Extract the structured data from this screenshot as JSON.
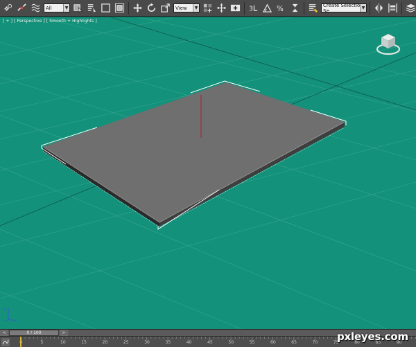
{
  "toolbar": {
    "selection_filter": "All",
    "reference_coord": "View",
    "named_selection": "Create Selection Se"
  },
  "viewport": {
    "label": "[ + ] [ Perspective ] [ Smooth + Highlights ]",
    "background": "#14917a"
  },
  "time_slider": {
    "value": "0 / 100",
    "prev_label": "<",
    "next_label": ">"
  },
  "track_bar": {
    "ticks": [
      "0",
      "5",
      "10",
      "15",
      "20",
      "25",
      "30",
      "35",
      "40",
      "45",
      "50",
      "55",
      "60",
      "65",
      "70",
      "75",
      "80",
      "85",
      "90"
    ]
  },
  "watermark": "pxleyes.com",
  "icons": {
    "toolbar": [
      "link-icon",
      "unlink-icon",
      "bind-spacewarp-icon",
      "select-object-icon",
      "select-by-name-icon",
      "rect-selection-icon",
      "window-crossing-icon",
      "move-icon",
      "rotate-icon",
      "scale-icon",
      "pivot-icon",
      "manipulate-icon",
      "snaps-icon",
      "angle-snap-icon",
      "percent-snap-icon",
      "spinner-snap-icon",
      "edit-named-sel-icon",
      "mirror-icon",
      "align-icon",
      "layer-manager-icon",
      "curve-editor-icon",
      "schematic-icon"
    ]
  }
}
